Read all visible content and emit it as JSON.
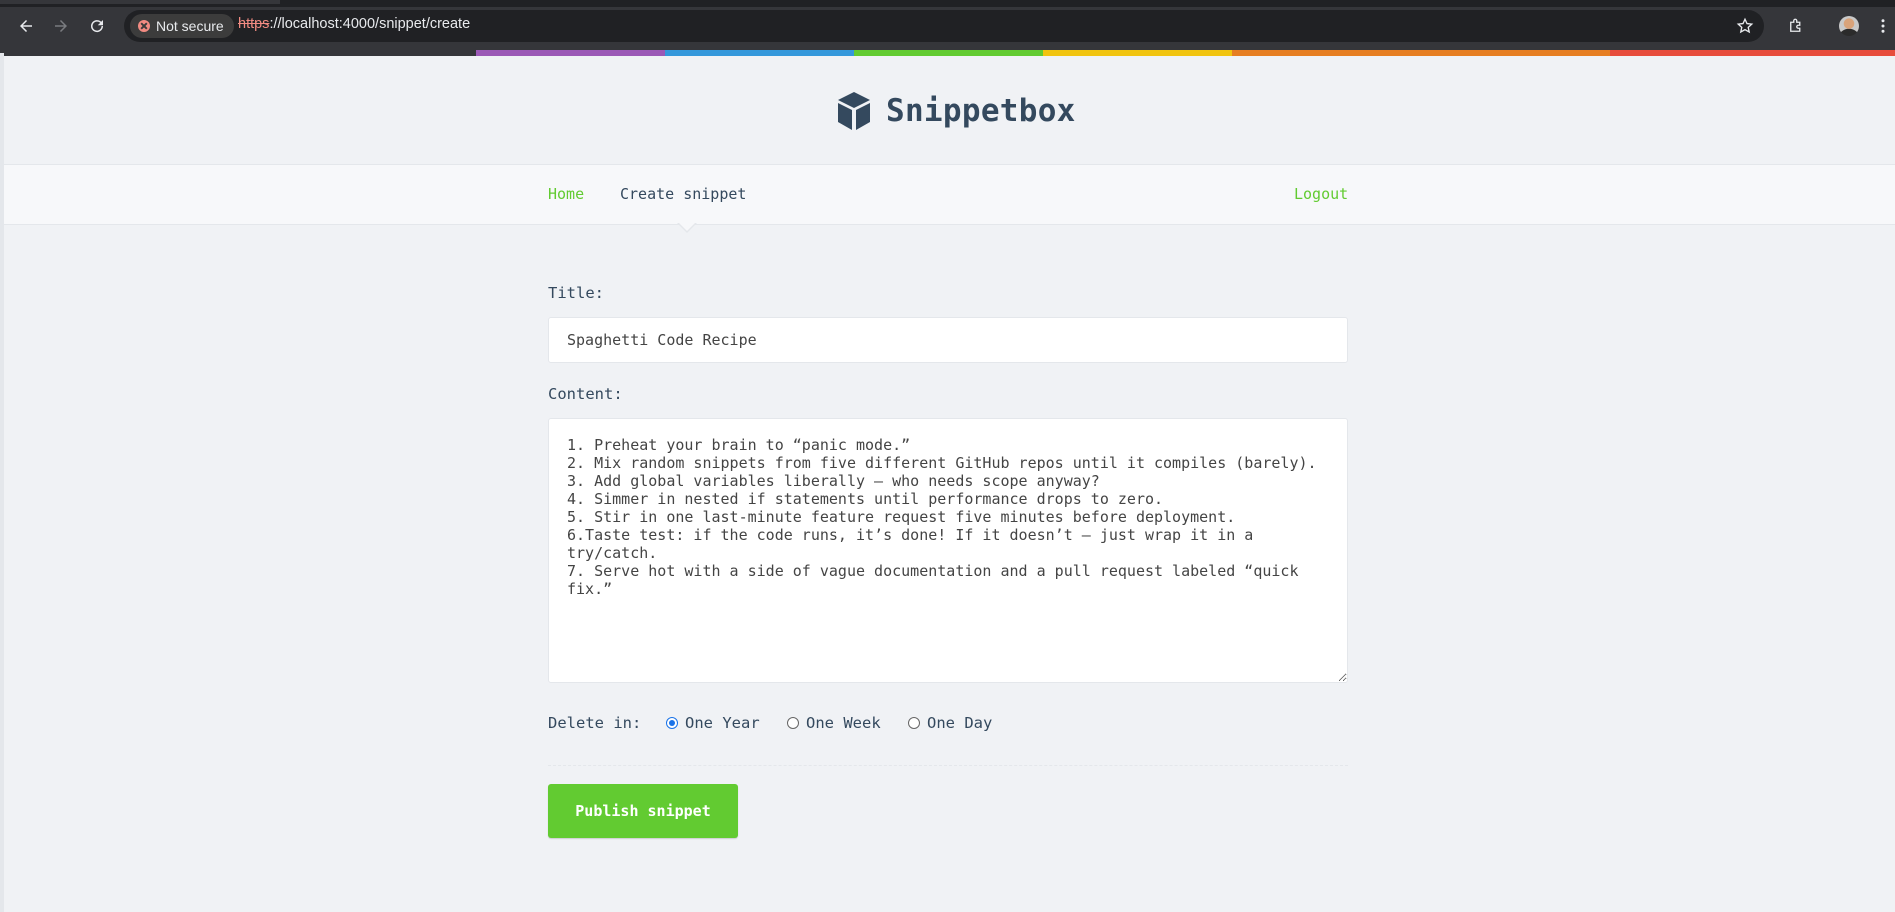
{
  "browser": {
    "security_label": "Not secure",
    "url_scheme": "https",
    "url_rest": "://localhost:4000/snippet/create",
    "icons": [
      "back-icon",
      "forward-icon",
      "reload-icon",
      "star-icon",
      "extensions-icon",
      "profile-avatar",
      "menu-icon"
    ]
  },
  "rainbow_colors": [
    "#9b59b6",
    "#3498db",
    "#62cb31",
    "#f1c40f",
    "#e67e22",
    "#e74c3c"
  ],
  "site": {
    "brand": "Snippetbox",
    "brand_color": "#34495e",
    "accent_color": "#62cb31"
  },
  "nav": {
    "home": "Home",
    "create": "Create snippet",
    "logout": "Logout"
  },
  "form": {
    "title_label": "Title:",
    "title_value": "Spaghetti Code Recipe",
    "content_label": "Content:",
    "content_value": "1. Preheat your brain to “panic mode.”\n2. Mix random snippets from five different GitHub repos until it compiles (barely).\n3. Add global variables liberally — who needs scope anyway?\n4. Simmer in nested if statements until performance drops to zero.\n5. Stir in one last-minute feature request five minutes before deployment.\n6.Taste test: if the code runs, it’s done! If it doesn’t — just wrap it in a try/catch.\n7. Serve hot with a side of vague documentation and a pull request labeled “quick fix.”",
    "delete_label": "Delete in:",
    "expires_options": [
      {
        "label": "One Year",
        "checked": true
      },
      {
        "label": "One Week",
        "checked": false
      },
      {
        "label": "One Day",
        "checked": false
      }
    ],
    "submit_label": "Publish snippet"
  }
}
